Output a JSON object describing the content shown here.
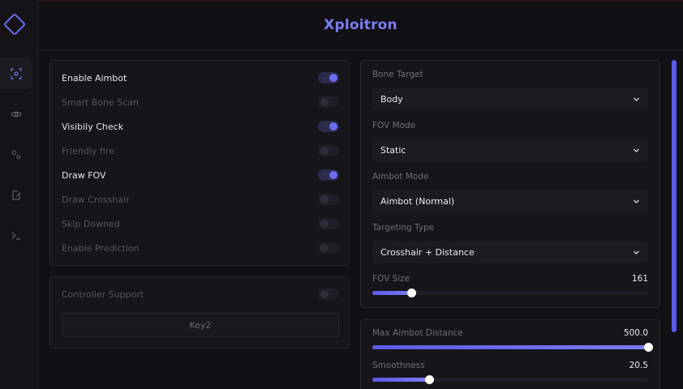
{
  "app": {
    "title": "Xploitron"
  },
  "colors": {
    "accent": "#6d6df0",
    "background": "#111115"
  },
  "sidebar": {
    "items": [
      {
        "icon": "crosshair-icon",
        "active": true
      },
      {
        "icon": "eye-icon",
        "active": false
      },
      {
        "icon": "settings-cogs-icon",
        "active": false
      },
      {
        "icon": "edit-document-icon",
        "active": false
      },
      {
        "icon": "terminal-icon",
        "active": false
      }
    ]
  },
  "toggles": [
    {
      "label": "Enable Aimbot",
      "enabled": true
    },
    {
      "label": "Smart Bone Scan",
      "enabled": false
    },
    {
      "label": "Visibily Check",
      "enabled": true
    },
    {
      "label": "Friendly fire",
      "enabled": false
    },
    {
      "label": "Draw FOV",
      "enabled": true
    },
    {
      "label": "Draw Crosshair",
      "enabled": false
    },
    {
      "label": "Skip Downed",
      "enabled": false
    },
    {
      "label": "Enable Prediction",
      "enabled": false
    }
  ],
  "controller": {
    "label": "Controller Support",
    "enabled": false,
    "key_label": "Key2"
  },
  "selects": [
    {
      "label": "Bone Target",
      "value": "Body"
    },
    {
      "label": "FOV Mode",
      "value": "Static"
    },
    {
      "label": "Aimbot Mode",
      "value": "Aimbot (Normal)"
    },
    {
      "label": "Targeting Type",
      "value": "Crosshair + Distance"
    }
  ],
  "sliders": {
    "fov_size": {
      "label": "FOV Size",
      "value": "161",
      "fraction": 0.14
    },
    "max_distance": {
      "label": "Max Aimbot Distance",
      "value": "500.0",
      "fraction": 1.0
    },
    "smoothness": {
      "label": "Smoothness",
      "value": "20.5",
      "fraction": 0.205
    }
  }
}
